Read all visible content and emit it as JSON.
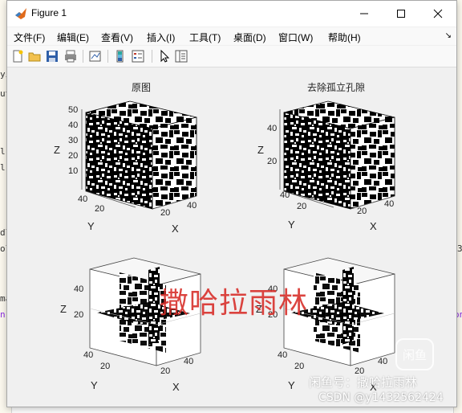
{
  "window": {
    "title": "Figure 1"
  },
  "menu": [
    {
      "label": "文件(F)"
    },
    {
      "label": "编辑(E)"
    },
    {
      "label": "查看(V)"
    },
    {
      "label": "插入(I)"
    },
    {
      "label": "工具(T)"
    },
    {
      "label": "桌面(D)"
    },
    {
      "label": "窗口(W)"
    },
    {
      "label": "帮助(H)"
    }
  ],
  "toolbar_icons": [
    "new-figure-icon",
    "open-file-icon",
    "save-icon",
    "print-icon",
    "link-plot-icon",
    "insert-colorbar-icon",
    "insert-legend-icon",
    "pointer-icon",
    "property-editor-icon"
  ],
  "background_editor": {
    "lines": [
      "yi",
      "ut",
      "l:",
      "l",
      "dl",
      "ol",
      "ma",
      "n"
    ],
    "right_fragments": [
      "3",
      "on"
    ]
  },
  "plots": {
    "top_left": {
      "title": "原图",
      "z_label": "Z",
      "x_label": "X",
      "y_label": "Y",
      "z_ticks": [
        "50",
        "40",
        "30",
        "20",
        "10"
      ],
      "x_ticks": [
        "20",
        "40"
      ],
      "y_ticks": [
        "40",
        "20"
      ]
    },
    "top_right": {
      "title": "去除孤立孔隙",
      "z_label": "Z",
      "x_label": "X",
      "y_label": "Y",
      "z_ticks": [
        "40",
        "20"
      ],
      "x_ticks": [
        "20",
        "40"
      ],
      "y_ticks": [
        "40",
        "20"
      ]
    },
    "bottom_left": {
      "z_label": "Z",
      "x_label": "X",
      "y_label": "Y",
      "z_ticks": [
        "40",
        "20"
      ],
      "x_ticks": [
        "20",
        "40"
      ],
      "y_ticks": [
        "40",
        "20"
      ]
    },
    "bottom_right": {
      "z_label": "Z",
      "x_label": "X",
      "y_label": "Y",
      "z_ticks": [
        "40",
        "20"
      ],
      "x_ticks": [
        "20",
        "40"
      ],
      "y_ticks": [
        "40",
        "20"
      ]
    }
  },
  "watermarks": {
    "big": "撒哈拉雨林",
    "small": "闲鱼号：撒哈拉雨林",
    "csdn": "CSDN @y1432562424",
    "logo": "闲鱼"
  }
}
